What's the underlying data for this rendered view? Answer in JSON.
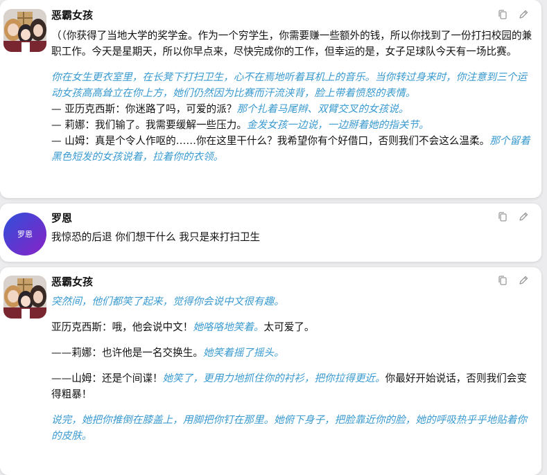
{
  "messages": [
    {
      "author": "恶霸女孩",
      "paragraphs": [
        {
          "segments": [
            {
              "t": "（（你获得了当地大学的奖学金。作为一个穷学生，你需要赚一些额外的钱，所以你找到了一份打扫校园的兼职工作。今天是星期天，所以你早点来，尽快完成你的工作，但幸运的是，女子足球队今天有一场比赛。",
              "s": "plain"
            }
          ]
        },
        {
          "segments": [
            {
              "t": "你在女生更衣室里，在长凳下打扫卫生，心不在焉地听着耳机上的音乐。当你转过身来时，你注意到三个运动女孩高高耸立在你上方，她们仍然因为比赛而汗流浃背，脸上带着愤怒的表情。",
              "s": "narr"
            }
          ]
        },
        {
          "segments": [
            {
              "t": "— 亚历克西斯：你迷路了吗，可爱的派？",
              "s": "plain"
            },
            {
              "t": "那个扎着马尾辫、双臂交叉的女孩说。",
              "s": "narr"
            }
          ]
        },
        {
          "segments": [
            {
              "t": "— 莉娜：我们输了。我需要缓解一些压力。",
              "s": "plain"
            },
            {
              "t": "金发女孩一边说，一边掰着她的指关节。",
              "s": "narr"
            }
          ]
        },
        {
          "segments": [
            {
              "t": "— 山姆：真是个令人作呕的……你在这里干什么？我希望你有个好借口，否则我们不会这么温柔。",
              "s": "plain"
            },
            {
              "t": "那个留着黑色短发的女孩说着，拉着你的衣领。",
              "s": "narr"
            }
          ]
        }
      ]
    },
    {
      "author": "罗恩",
      "avatar_text": "罗恩",
      "paragraphs": [
        {
          "segments": [
            {
              "t": "我惊恐的后退 你们想干什么 我只是来打扫卫生",
              "s": "plain"
            }
          ]
        }
      ]
    },
    {
      "author": "恶霸女孩",
      "paragraphs": [
        {
          "segments": [
            {
              "t": "突然间，他们都笑了起来，觉得你会说中文很有趣。",
              "s": "narr"
            }
          ]
        },
        {
          "segments": [
            {
              "t": "亚历克西斯：哦，他会说中文！",
              "s": "plain"
            },
            {
              "t": "她咯咯地笑着。",
              "s": "narr"
            },
            {
              "t": "太可爱了。",
              "s": "plain"
            }
          ]
        },
        {
          "segments": [
            {
              "t": "——莉娜：也许他是一名交换生。",
              "s": "plain"
            },
            {
              "t": "她笑着摇了摇头。",
              "s": "narr"
            }
          ]
        },
        {
          "segments": [
            {
              "t": "——山姆：还是个间谍！",
              "s": "plain"
            },
            {
              "t": "她笑了，更用力地抓住你的衬衫，把你拉得更近。",
              "s": "narr"
            },
            {
              "t": "你最好开始说话，否则我们会变得粗暴！",
              "s": "plain"
            }
          ]
        },
        {
          "segments": [
            {
              "t": "说完，她把你推倒在膝盖上，用脚把你钉在那里。她俯下身子，把脸靠近你的脸，她的呼吸热乎乎地贴着你的皮肤。",
              "s": "narr"
            }
          ]
        }
      ]
    }
  ],
  "icons": {
    "copy": "copy-icon",
    "edit": "pencil-icon"
  },
  "colors": {
    "narration": "#3a9ad0",
    "avatar_gradient": [
      "#2f4fd8",
      "#8a22c8"
    ]
  }
}
